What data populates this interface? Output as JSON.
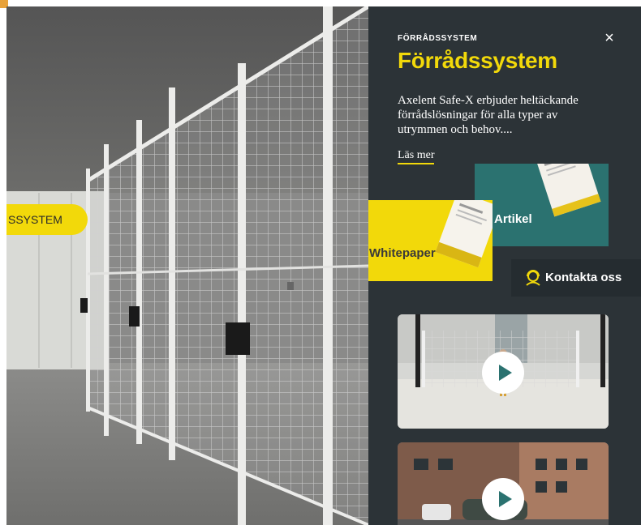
{
  "scene": {
    "section_label": "SSYSTEM"
  },
  "panel": {
    "eyebrow": "FÖRRÅDSSYSTEM",
    "title": "Förrådssystem",
    "close_label": "×",
    "description": "Axelent Safe-X erbjuder heltäckande förrådslösningar för alla typer av utrymmen och behov....",
    "read_more": "Läs mer",
    "cards": {
      "article_label": "Artikel",
      "whitepaper_label": "Whitepaper"
    },
    "contact_label": "Kontakta oss",
    "videos": [
      {
        "icon": "play-icon"
      },
      {
        "icon": "play-icon"
      }
    ]
  },
  "colors": {
    "accent_yellow": "#f2d90a",
    "teal": "#2b7270",
    "panel_bg": "#2c3337"
  }
}
